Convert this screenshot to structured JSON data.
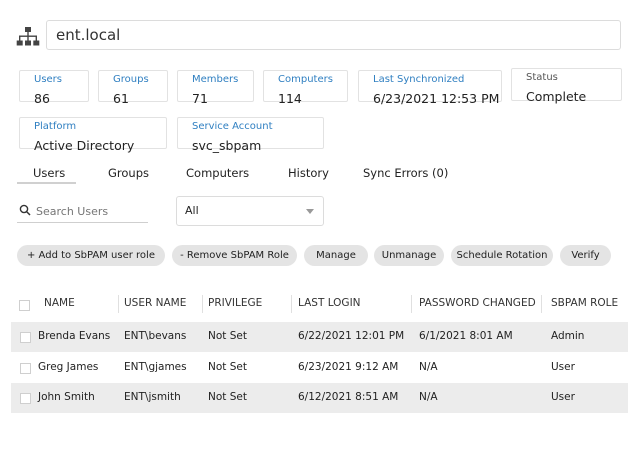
{
  "domain": {
    "name": "ent.local",
    "icon": "network-hierarchy-icon"
  },
  "stats": {
    "users": {
      "label": "Users",
      "value": "86"
    },
    "groups": {
      "label": "Groups",
      "value": "61"
    },
    "members": {
      "label": "Members",
      "value": "71"
    },
    "computers": {
      "label": "Computers",
      "value": "114"
    },
    "last_sync": {
      "label": "Last Synchronized",
      "value": "6/23/2021 12:53 PM"
    },
    "status": {
      "label": "Status",
      "value": "Complete"
    }
  },
  "info": {
    "platform": {
      "label": "Platform",
      "value": "Active Directory"
    },
    "service_account": {
      "label": "Service Account",
      "value": "svc_sbpam"
    }
  },
  "tabs": [
    {
      "label": "Users",
      "active": true
    },
    {
      "label": "Groups"
    },
    {
      "label": "Computers"
    },
    {
      "label": "History"
    },
    {
      "label": "Sync Errors (0)"
    }
  ],
  "search": {
    "placeholder": "Search Users",
    "icon": "search-icon"
  },
  "filter": {
    "value": "All"
  },
  "actions": [
    "+ Add to SbPAM user role",
    "- Remove SbPAM Role",
    "Manage",
    "Unmanage",
    "Schedule Rotation",
    "Verify"
  ],
  "table": {
    "columns": [
      "NAME",
      "USER NAME",
      "PRIVILEGE",
      "LAST LOGIN",
      "PASSWORD CHANGED",
      "SBPAM ROLE"
    ],
    "rows": [
      [
        "Brenda Evans",
        "ENT\\bevans",
        "Not Set",
        "6/22/2021 12:01 PM",
        "6/1/2021 8:01 AM",
        "Admin"
      ],
      [
        "Greg James",
        "ENT\\gjames",
        "Not Set",
        "6/23/2021 9:12 AM",
        "N/A",
        "User"
      ],
      [
        "John Smith",
        "ENT\\jsmith",
        "Not Set",
        "6/12/2021 8:51 AM",
        "N/A",
        "User"
      ]
    ]
  },
  "colors": {
    "accent": "#2f7fc1",
    "button_bg": "#e4e4e4",
    "row_alt": "#ececec"
  }
}
